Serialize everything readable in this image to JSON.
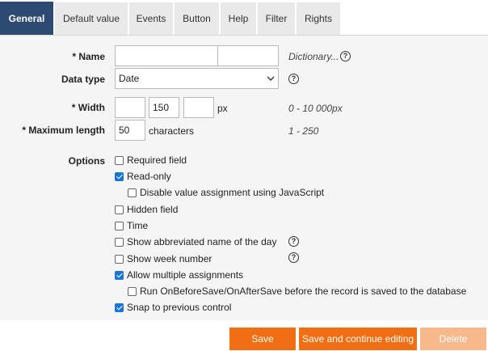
{
  "tabs": [
    "General",
    "Default value",
    "Events",
    "Button",
    "Help",
    "Filter",
    "Rights"
  ],
  "form": {
    "name_label": "* Name",
    "name_value_1": "",
    "name_value_2": "",
    "name_hint": "Dictionary...",
    "datatype_label": "Data type",
    "datatype_value": "Date",
    "width_label": "* Width",
    "width_value_1": "",
    "width_value_2": "150",
    "width_value_3": "",
    "width_unit": "px",
    "width_hint": "0 - 10 000px",
    "maxlen_label": "* Maximum length",
    "maxlen_value": "50",
    "maxlen_unit": "characters",
    "maxlen_hint": "1 - 250",
    "options_label": "Options"
  },
  "options": [
    {
      "label": "Required field",
      "checked": false
    },
    {
      "label": "Read-only",
      "checked": true
    },
    {
      "label": "Disable value assignment using JavaScript",
      "checked": false
    },
    {
      "label": "Hidden field",
      "checked": false
    },
    {
      "label": "Time",
      "checked": false
    },
    {
      "label": "Show abbreviated name of the day",
      "checked": false
    },
    {
      "label": "Show week number",
      "checked": false
    },
    {
      "label": "Allow multiple assignments",
      "checked": true
    },
    {
      "label": "Run OnBeforeSave/OnAfterSave before the record is saved to the database",
      "checked": false
    },
    {
      "label": "Snap to previous control",
      "checked": true
    }
  ],
  "buttons": {
    "save": "Save",
    "save_continue": "Save and continue editing",
    "delete": "Delete"
  },
  "colors": {
    "tab_active": "#2d4a73",
    "button_orange": "#f26e12",
    "button_disabled": "#f7b88c",
    "checkbox_checked": "#1976d2"
  }
}
